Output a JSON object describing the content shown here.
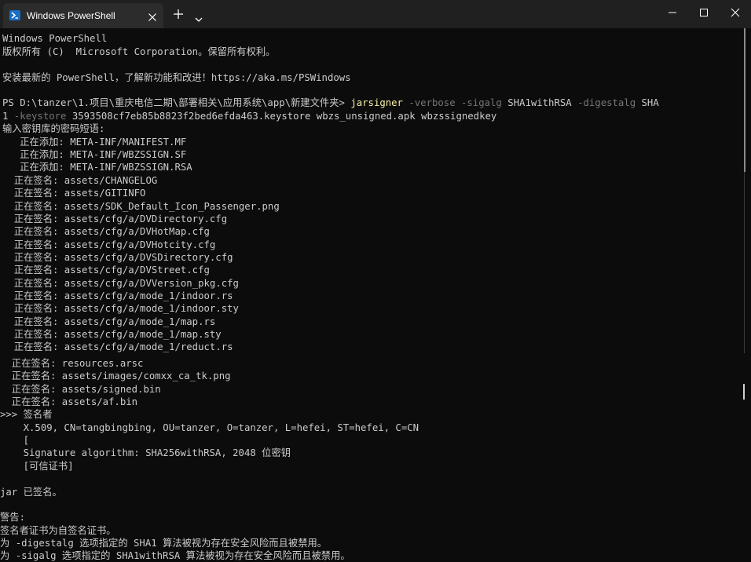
{
  "window": {
    "tab_title": "Windows PowerShell",
    "tab_icon": "powershell-icon",
    "new_tab_label": "+",
    "accent": "#1a6fc7"
  },
  "terminal": {
    "banner_1": "Windows PowerShell",
    "banner_2": "版权所有 (C)  Microsoft Corporation。保留所有权利。",
    "banner_3": "安装最新的 PowerShell，了解新功能和改进！https://aka.ms/PSWindows",
    "prompt": "PS D:\\tanzer\\1.项目\\重庆电信二期\\部署相关\\应用系统\\app\\新建文件夹> ",
    "cmd_exe": "jarsigner",
    "cmd_p1": " -verbose -sigalg ",
    "cmd_a1": "SHA1withRSA",
    "cmd_p2": " -digestalg ",
    "cmd_a2": "SHA",
    "cmd_a3": "1",
    "cmd_p3": " -keystore ",
    "cmd_a4": "3593508cf7eb85b8823f2bed6efda463.keystore wbzs_unsigned.apk wbzssignedkey",
    "input_prompt": "输入密钥库的密码短语:",
    "upper_lines": [
      "   正在添加: META-INF/MANIFEST.MF",
      "   正在添加: META-INF/WBZSSIGN.SF",
      "   正在添加: META-INF/WBZSSIGN.RSA",
      "  正在签名: assets/CHANGELOG",
      "  正在签名: assets/GITINFO",
      "  正在签名: assets/SDK_Default_Icon_Passenger.png",
      "  正在签名: assets/cfg/a/DVDirectory.cfg",
      "  正在签名: assets/cfg/a/DVHotMap.cfg",
      "  正在签名: assets/cfg/a/DVHotcity.cfg",
      "  正在签名: assets/cfg/a/DVSDirectory.cfg",
      "  正在签名: assets/cfg/a/DVStreet.cfg",
      "  正在签名: assets/cfg/a/DVVersion_pkg.cfg",
      "  正在签名: assets/cfg/a/mode_1/indoor.rs",
      "  正在签名: assets/cfg/a/mode_1/indoor.sty",
      "  正在签名: assets/cfg/a/mode_1/map.rs",
      "  正在签名: assets/cfg/a/mode_1/map.sty",
      "  正在签名: assets/cfg/a/mode_1/reduct.rs"
    ],
    "lower_lines": [
      "  正在签名: resources.arsc",
      "  正在签名: assets/images/comxx_ca_tk.png",
      "  正在签名: assets/signed.bin",
      "  正在签名: assets/af.bin",
      ">>> 签名者",
      "    X.509, CN=tangbingbing, OU=tanzer, O=tanzer, L=hefei, ST=hefei, C=CN",
      "    [",
      "    Signature algorithm: SHA256withRSA, 2048 位密钥",
      "    [可信证书]",
      "",
      "jar 已签名。",
      "",
      "警告:",
      "签名者证书为自签名证书。",
      "为 -digestalg 选项指定的 SHA1 算法被视为存在安全风险而且被禁用。",
      "为 -sigalg 选项指定的 SHA1withRSA 算法被视为存在安全风险而且被禁用。"
    ]
  }
}
